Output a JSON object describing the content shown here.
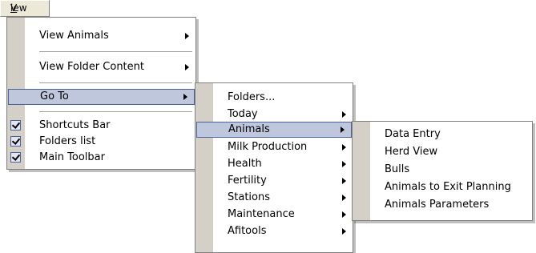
{
  "menubar": {
    "view_prefix": "V",
    "view_rest": "iew"
  },
  "view_menu": {
    "items": [
      {
        "label": "View Animals"
      },
      {
        "label": "View Folder Content"
      },
      {
        "label": "Go To"
      },
      {
        "label": "Shortcuts Bar"
      },
      {
        "label": "Folders list"
      },
      {
        "label": "Main Toolbar"
      }
    ]
  },
  "goto_menu": {
    "items": [
      {
        "label": "Folders..."
      },
      {
        "label": "Today"
      },
      {
        "label": "Animals"
      },
      {
        "label": "Milk Production"
      },
      {
        "label": "Health"
      },
      {
        "label": "Fertility"
      },
      {
        "label": "Stations"
      },
      {
        "label": "Maintenance"
      },
      {
        "label": "Afitools"
      }
    ]
  },
  "animals_menu": {
    "items": [
      {
        "label": "Data Entry"
      },
      {
        "label": "Herd View"
      },
      {
        "label": "Bulls"
      },
      {
        "label": "Animals to Exit Planning"
      },
      {
        "label": "Animals Parameters"
      }
    ]
  }
}
